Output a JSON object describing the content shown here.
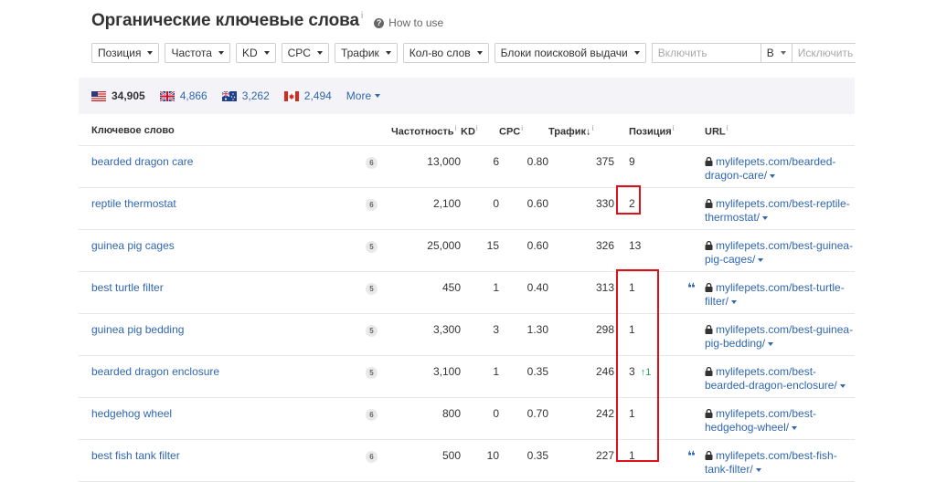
{
  "header": {
    "title": "Органические ключевые слова",
    "title_info": "i",
    "how_to": "How to use",
    "how_to_icon": "?"
  },
  "filters": {
    "position": "Позиция",
    "frequency": "Частота",
    "kd": "KD",
    "cpc": "CPC",
    "traffic": "Трафик",
    "word_count": "Кол-во слов",
    "serp_blocks": "Блоки поисковой выдачи",
    "include_placeholder": "Включить",
    "include_mode": "В",
    "exclude_placeholder": "Исключить"
  },
  "countries": [
    {
      "code": "us",
      "count": "34,905"
    },
    {
      "code": "gb",
      "count": "4,866"
    },
    {
      "code": "au",
      "count": "3,262"
    },
    {
      "code": "ca",
      "count": "2,494"
    }
  ],
  "more_label": "More",
  "columns": {
    "keyword": "Ключевое слово",
    "volume": "Частотность",
    "kd": "KD",
    "cpc": "CPC",
    "traffic": "Трафик",
    "traffic_sort": "↓",
    "position": "Позиция",
    "url": "URL",
    "info": "i"
  },
  "rows": [
    {
      "keyword": "bearded dragon care",
      "serp": "6",
      "volume": "13,000",
      "kd": "6",
      "cpc": "0.80",
      "traffic": "375",
      "position": "9",
      "change": "",
      "quote": "",
      "url1": "mylifepets.com/bearded-",
      "url2": "dragon-care/"
    },
    {
      "keyword": "reptile thermostat",
      "serp": "6",
      "volume": "2,100",
      "kd": "0",
      "cpc": "0.60",
      "traffic": "330",
      "position": "2",
      "change": "",
      "quote": "",
      "url1": "mylifepets.com/best-reptile-",
      "url2": "thermostat/"
    },
    {
      "keyword": "guinea pig cages",
      "serp": "5",
      "volume": "25,000",
      "kd": "15",
      "cpc": "0.60",
      "traffic": "326",
      "position": "13",
      "change": "",
      "quote": "",
      "url1": "mylifepets.com/best-guinea-",
      "url2": "pig-cages/"
    },
    {
      "keyword": "best turtle filter",
      "serp": "5",
      "volume": "450",
      "kd": "1",
      "cpc": "0.40",
      "traffic": "313",
      "position": "1",
      "change": "",
      "quote": "❛❛",
      "url1": "mylifepets.com/best-turtle-",
      "url2": "filter/"
    },
    {
      "keyword": "guinea pig bedding",
      "serp": "5",
      "volume": "3,300",
      "kd": "3",
      "cpc": "1.30",
      "traffic": "298",
      "position": "1",
      "change": "",
      "quote": "",
      "url1": "mylifepets.com/best-guinea-",
      "url2": "pig-bedding/"
    },
    {
      "keyword": "bearded dragon enclosure",
      "serp": "5",
      "volume": "3,100",
      "kd": "1",
      "cpc": "0.35",
      "traffic": "246",
      "position": "3",
      "change": "↑1",
      "quote": "",
      "url1": "mylifepets.com/best-",
      "url2": "bearded-dragon-enclosure/"
    },
    {
      "keyword": "hedgehog wheel",
      "serp": "6",
      "volume": "800",
      "kd": "0",
      "cpc": "0.70",
      "traffic": "242",
      "position": "1",
      "change": "",
      "quote": "",
      "url1": "mylifepets.com/best-",
      "url2": "hedgehog-wheel/"
    },
    {
      "keyword": "best fish tank filter",
      "serp": "6",
      "volume": "500",
      "kd": "10",
      "cpc": "0.35",
      "traffic": "227",
      "position": "1",
      "change": "",
      "quote": "❛❛",
      "url1": "mylifepets.com/best-fish-",
      "url2": "tank-filter/"
    }
  ],
  "colors": {
    "link": "#3066b2",
    "highlight": "#e0101a",
    "band": "#f4f4f8",
    "up": "#2ca55f"
  }
}
